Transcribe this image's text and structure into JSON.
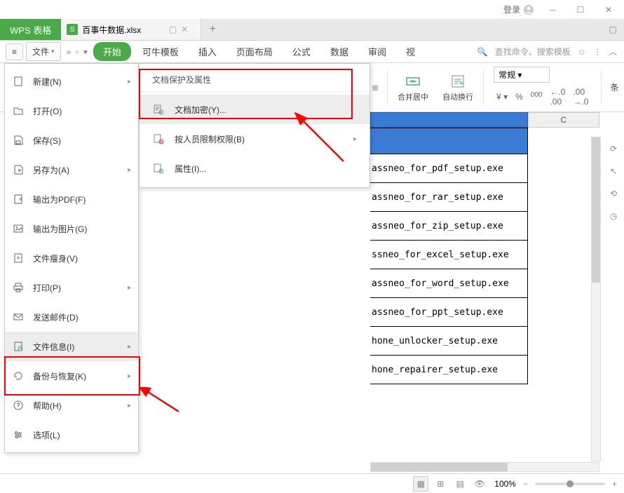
{
  "titlebar": {
    "login": "登录"
  },
  "tabs": {
    "wps": "WPS 表格",
    "doc": "百事牛数据.xlsx"
  },
  "ribbon_tabs": [
    "开始",
    "可牛模板",
    "插入",
    "页面布局",
    "公式",
    "数据",
    "审阅",
    "视"
  ],
  "search_placeholder": "查找命令、搜索模板",
  "menu_label": "文件",
  "file_menu": [
    {
      "label": "新建(N)",
      "arrow": true
    },
    {
      "label": "打开(O)"
    },
    {
      "label": "保存(S)"
    },
    {
      "label": "另存为(A)",
      "arrow": true
    },
    {
      "label": "输出为PDF(F)"
    },
    {
      "label": "输出为图片(G)"
    },
    {
      "label": "文件瘦身(V)"
    },
    {
      "label": "打印(P)",
      "arrow": true
    },
    {
      "label": "发送邮件(D)"
    },
    {
      "label": "文件信息(I)",
      "arrow": true
    },
    {
      "label": "备份与恢复(K)",
      "arrow": true
    },
    {
      "label": "帮助(H)",
      "arrow": true
    },
    {
      "label": "选项(L)"
    }
  ],
  "submenu": {
    "header": "文档保护及属性",
    "items": [
      {
        "label": "文档加密(Y)..."
      },
      {
        "label": "按人员限制权限(B)",
        "arrow": true
      },
      {
        "label": "属性(I)..."
      }
    ]
  },
  "ribbon_items": {
    "merge": "合并居中",
    "wrap": "自动换行",
    "format": "常规",
    "end": "条"
  },
  "cells": [
    "assneo_for_pdf_setup.exe",
    "assneo_for_rar_setup.exe",
    "assneo_for_zip_setup.exe",
    "ssneo_for_excel_setup.exe",
    "assneo_for_word_setup.exe",
    "assneo_for_ppt_setup.exe",
    "hone_unlocker_setup.exe",
    "hone_repairer_setup.exe"
  ],
  "col_c": "C",
  "zoom": "100%"
}
